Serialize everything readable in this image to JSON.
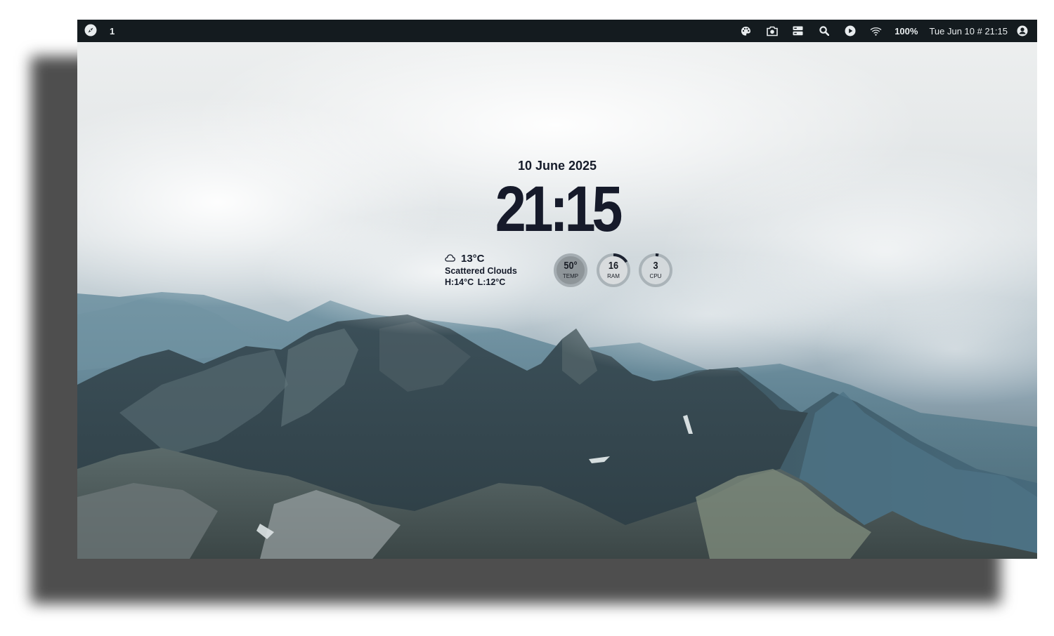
{
  "topbar": {
    "workspace": "1",
    "battery": "100%",
    "datetime": "Tue Jun 10 # 21:15",
    "icons": [
      "compass-icon",
      "palette-icon",
      "camera-icon",
      "server-icon",
      "search-icon",
      "play-icon",
      "wifi-icon",
      "user-icon"
    ]
  },
  "widget": {
    "date": "10 June 2025",
    "time": "21:15"
  },
  "weather": {
    "icon": "cloud-icon",
    "temp": "13°C",
    "condition": "Scattered Clouds",
    "high": "H:14°C",
    "low": "L:12°C"
  },
  "gauges": [
    {
      "value": "50°",
      "label": "TEMP",
      "level": 0.0
    },
    {
      "value": "16",
      "label": "RAM",
      "level": 0.16
    },
    {
      "value": "3",
      "label": "CPU",
      "level": 0.03
    }
  ],
  "colors": {
    "bar_bg": "#141b1f",
    "text_dark": "#161a2a"
  }
}
